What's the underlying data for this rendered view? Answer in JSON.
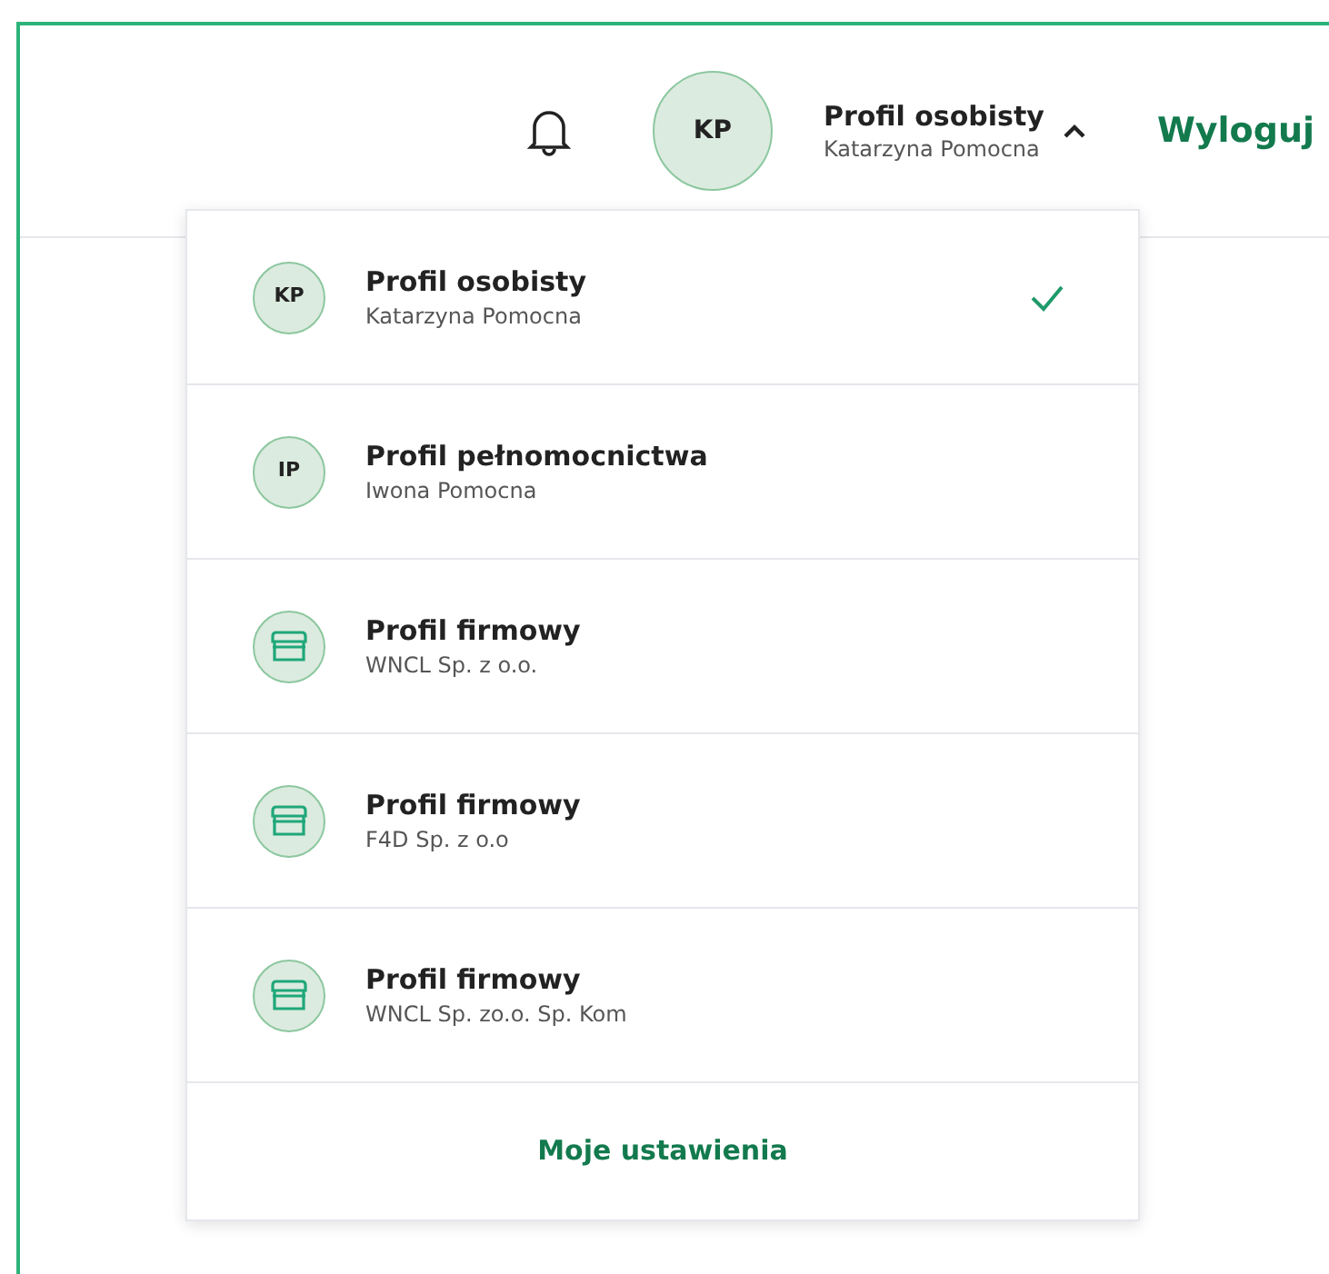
{
  "header": {
    "profile_title": "Profil osobisty",
    "profile_name": "Katarzyna Pomocna",
    "avatar_initials": "KP",
    "expanded": true,
    "logout": "Wyloguj"
  },
  "profiles": [
    {
      "kind": "person",
      "initials": "KP",
      "title": "Profil osobisty",
      "name": "Katarzyna Pomocna",
      "selected": true
    },
    {
      "kind": "person",
      "initials": "IP",
      "title": "Profil pełnomocnictwa",
      "name": "Iwona Pomocna",
      "selected": false
    },
    {
      "kind": "company",
      "title": "Profil firmowy",
      "name": "WNCL Sp. z o.o.",
      "selected": false
    },
    {
      "kind": "company",
      "title": "Profil firmowy",
      "name": "F4D Sp. z o.o",
      "selected": false
    },
    {
      "kind": "company",
      "title": "Profil firmowy",
      "name": "WNCL Sp. zo.o. Sp. Kom",
      "selected": false
    }
  ],
  "settings_link": "Moje ustawienia"
}
